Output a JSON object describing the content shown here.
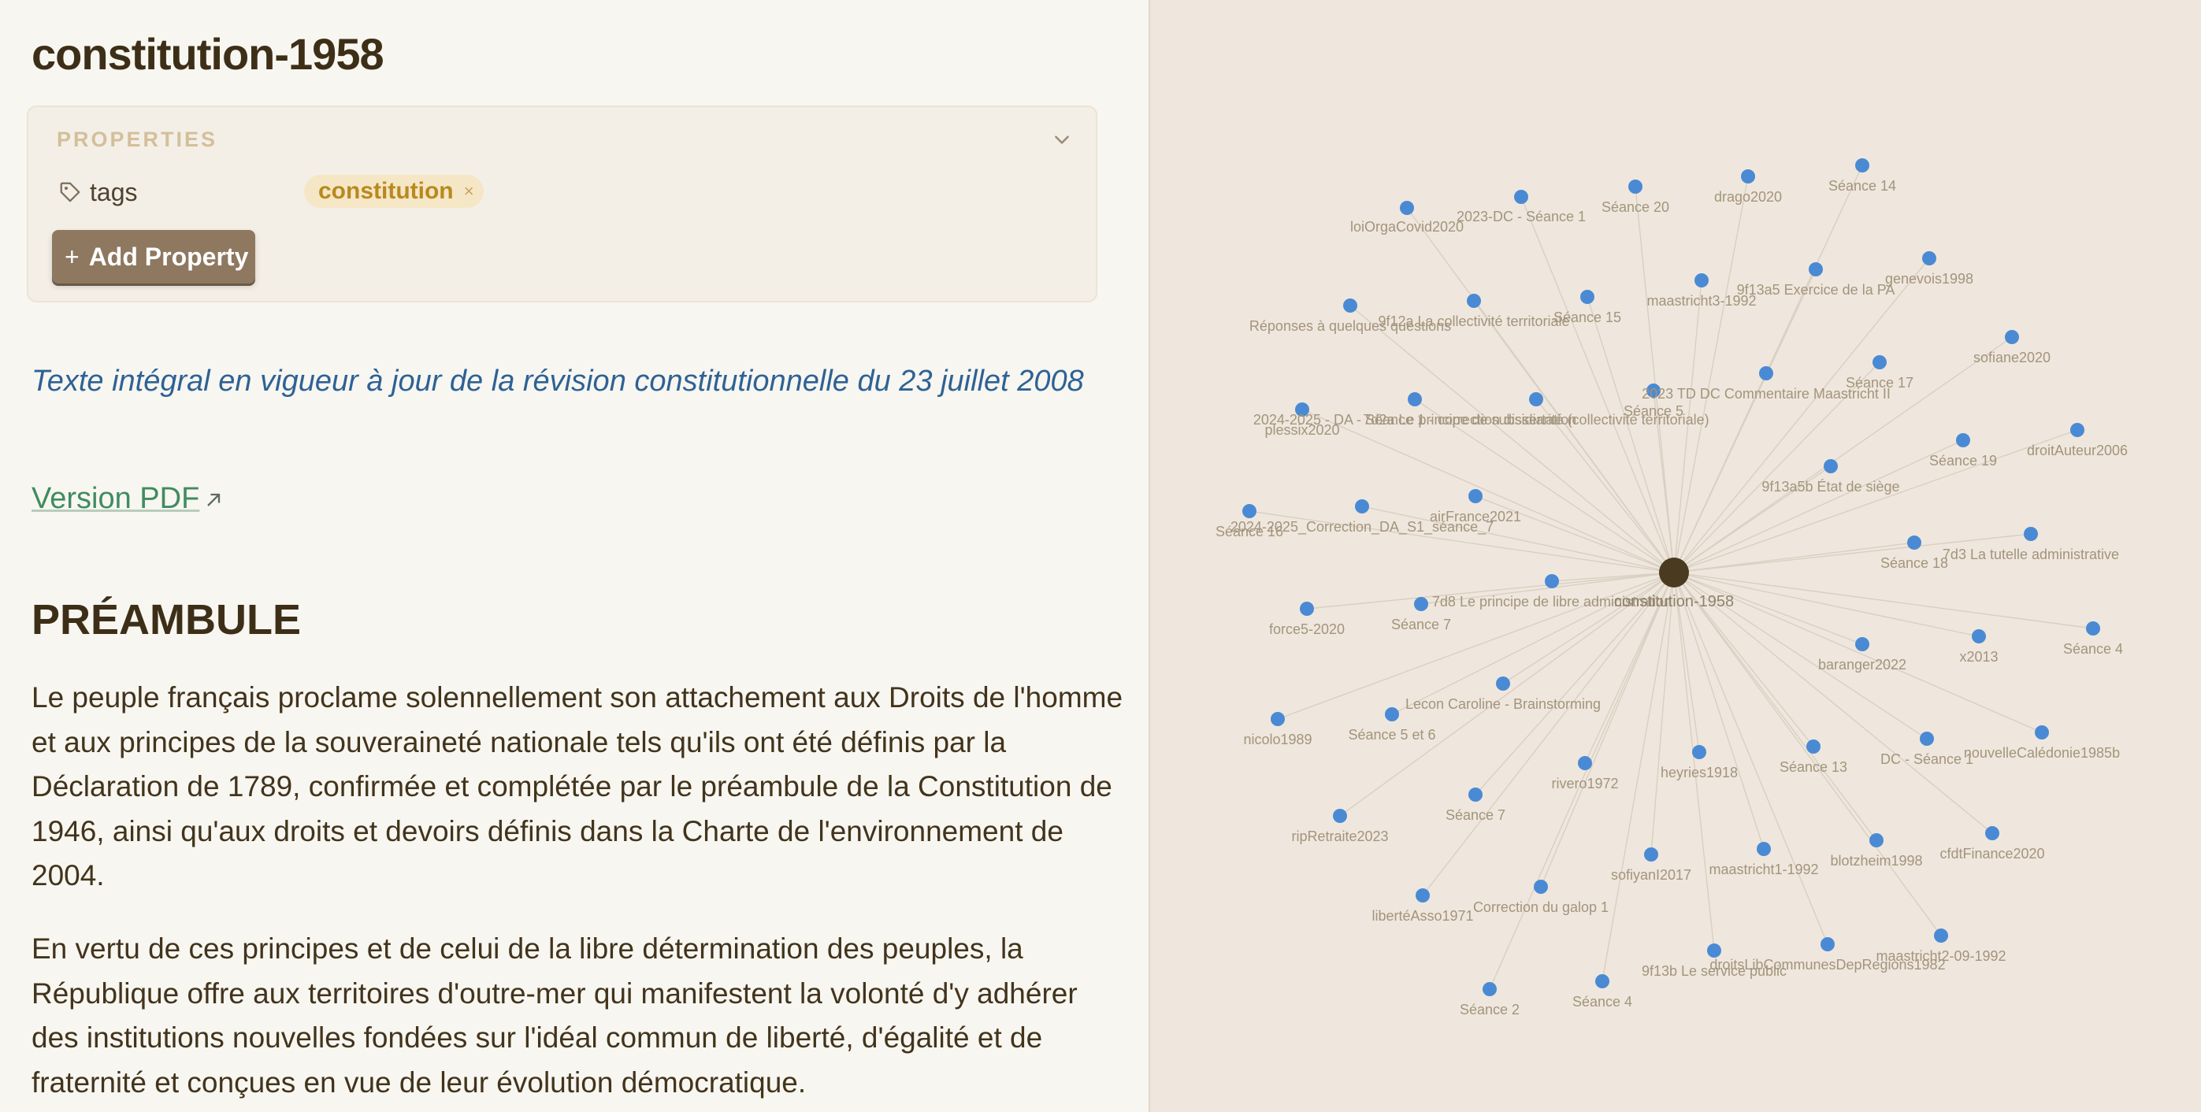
{
  "note": {
    "title": "constitution-1958",
    "properties_label": "PROPERTIES",
    "property_key": "tags",
    "tag_value": "constitution",
    "tag_remove": "×",
    "add_property_label": "Add Property",
    "add_property_plus": "+",
    "subtitle": "Texte intégral en vigueur à jour de la révision constitutionnelle du 23 juillet 2008",
    "pdf_link": "Version PDF",
    "heading": "PRÉAMBULE",
    "paragraphs": [
      "Le peuple français proclame solennellement son attachement aux Droits de l'homme et aux principes de la souveraineté nationale tels qu'ils ont été définis par la Déclaration de 1789, confirmée et complétée par le préambule de la Constitution de 1946, ainsi qu'aux droits et devoirs définis dans la Charte de l'environnement de 2004.",
      "En vertu de ces principes et de celui de la libre détermination des peuples, la République offre aux territoires d'outre-mer qui manifestent la volonté d'y adhérer des institutions nouvelles fondées sur l'idéal commun de liberté, d'égalité et de fraternité et conçues en vue de leur évolution démocratique."
    ]
  },
  "graph": {
    "center": "constitution-1958",
    "nodes": [
      "loiOrgaCovid2020",
      "2023-DC - Séance 1",
      "Séance 20",
      "drago2020",
      "Séance 14",
      "Réponses à quelques questions",
      "9f12a La collectivité territoriale",
      "Séance 15",
      "maastricht3-1992",
      "9f13a5 Exercice de la PA",
      "genevois1998",
      "sofiane2020",
      "plessix2020",
      "2024-2025 - DA - Séance 1 - correction dissertation",
      "7d2a Le principe de subsidiarité (collectivité territoriale)",
      "Séance 5",
      "2023 TD DC Commentaire Maastricht II",
      "Séance 17",
      "Séance 19",
      "droitAuteur2006",
      "9f13a5b État de siège",
      "Séance 16",
      "2024-2025_Correction_DA_S1_séance_7",
      "airFrance2021",
      "7d3 La tutelle administrative",
      "Séance 18",
      "force5-2020",
      "Séance 7",
      "7d8 Le principe de libre administration",
      "baranger2022",
      "x2013",
      "Séance 4",
      "Lecon Caroline - Brainstorming",
      "nicolo1989",
      "Séance 5 et 6",
      "nouvelleCalédonie1985b",
      "DC - Séance 1",
      "rivero1972",
      "heyries1918",
      "Séance 13",
      "ripRetraite2023",
      "Séance 7",
      "sofiyanI2017",
      "maastricht1-1992",
      "blotzheim1998",
      "cfdtFinance2020",
      "libertéAsso1971",
      "Correction du galop 1",
      "droitsLibCommunesDepRegions1982",
      "9f13b Le service public",
      "maastricht2-09-1992",
      "Séance 2",
      "Séance 4"
    ]
  },
  "colors": {
    "node": "#4a8ad4",
    "center_node": "#4a3a20",
    "edge": "#d9cfc2",
    "accent_tag": "#b8891e",
    "link": "#3f8c5f",
    "subtitle": "#2e6294"
  }
}
